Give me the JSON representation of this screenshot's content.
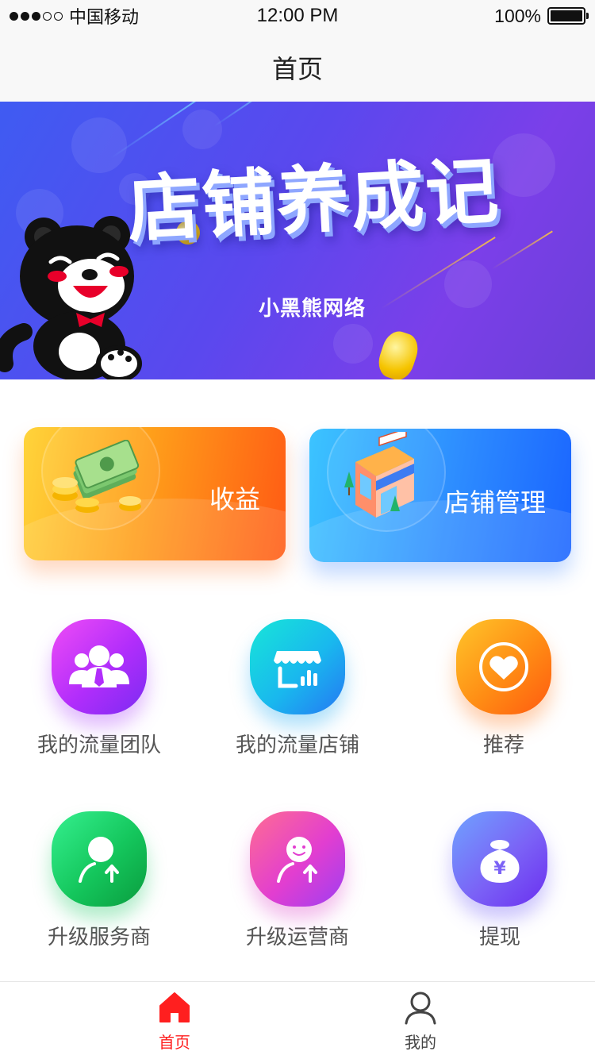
{
  "status_bar": {
    "carrier": "中国移动",
    "time": "12:00 PM",
    "battery": "100%"
  },
  "nav": {
    "title": "首页"
  },
  "banner": {
    "title": "店铺养成记",
    "subtitle": "小黑熊网络"
  },
  "cards": [
    {
      "label": "收益",
      "icon": "money-stack-icon",
      "color": "#ff7a1a"
    },
    {
      "label": "店铺管理",
      "icon": "shop-building-icon",
      "color": "#2d8cff"
    }
  ],
  "grid": [
    {
      "label": "我的流量团队",
      "icon": "team-icon"
    },
    {
      "label": "我的流量店铺",
      "icon": "store-stats-icon"
    },
    {
      "label": "推荐",
      "icon": "heart-icon"
    },
    {
      "label": "升级服务商",
      "icon": "user-upgrade-icon"
    },
    {
      "label": "升级运营商",
      "icon": "smile-upgrade-icon"
    },
    {
      "label": "提现",
      "icon": "money-bag-icon"
    }
  ],
  "tabs": [
    {
      "label": "首页",
      "icon": "home-icon",
      "active": true,
      "color": "#ff1f1f"
    },
    {
      "label": "我的",
      "icon": "person-icon",
      "active": false
    }
  ]
}
